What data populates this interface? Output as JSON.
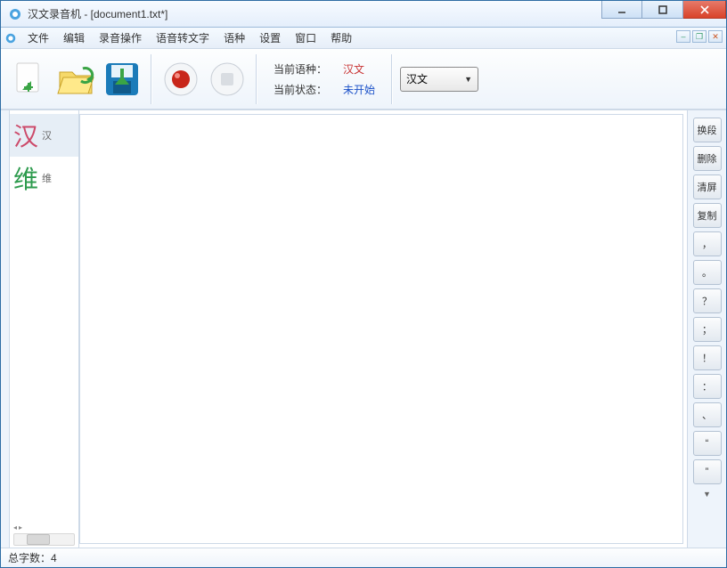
{
  "title": "汉文录音机 - [document1.txt*]",
  "menus": [
    "文件",
    "编辑",
    "录音操作",
    "语音转文字",
    "语种",
    "设置",
    "窗口",
    "帮助"
  ],
  "status_labels": {
    "lang": "当前语种：",
    "state": "当前状态："
  },
  "status_values": {
    "lang": "汉文",
    "state": "未开始"
  },
  "combo": {
    "selected": "汉文"
  },
  "lang_tabs": [
    {
      "big": "汉",
      "small": "汉",
      "cls": "han",
      "active": true
    },
    {
      "big": "维",
      "small": "维",
      "cls": "wei",
      "active": false
    }
  ],
  "right_buttons": [
    "换段",
    "删除",
    "清屏",
    "复制",
    "，",
    "。",
    "？",
    "；",
    "！",
    "：",
    "、",
    "“",
    "”"
  ],
  "statusbar": {
    "label": "总字数：",
    "value": "4"
  }
}
